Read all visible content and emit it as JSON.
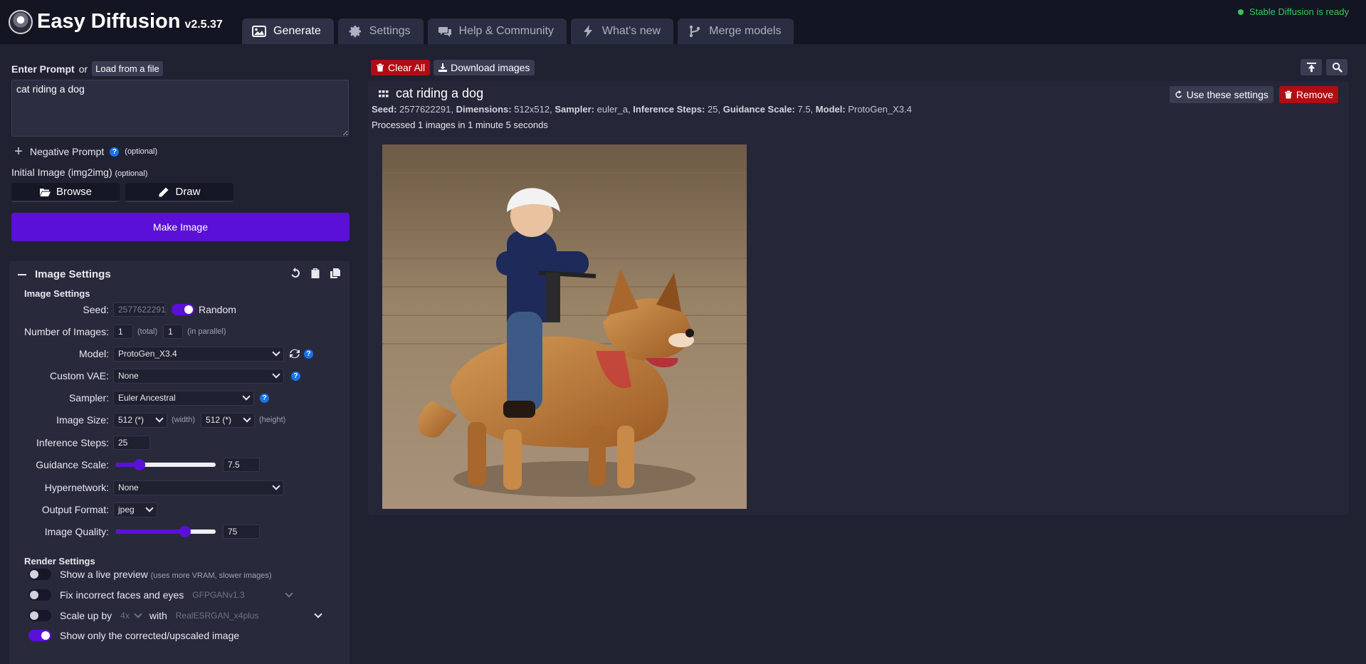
{
  "app": {
    "name": "Easy Diffusion",
    "version": "v2.5.37",
    "status": "Stable Diffusion is ready"
  },
  "tabs": [
    {
      "label": "Generate",
      "icon": "image-icon",
      "active": true
    },
    {
      "label": "Settings",
      "icon": "gear-icon",
      "active": false
    },
    {
      "label": "Help & Community",
      "icon": "comments-icon",
      "active": false
    },
    {
      "label": "What's new",
      "icon": "bolt-icon",
      "active": false
    },
    {
      "label": "Merge models",
      "icon": "code-branch-icon",
      "active": false
    }
  ],
  "prompt": {
    "label": "Enter Prompt",
    "or": "or",
    "load_button": "Load from a file",
    "value": "cat riding a dog",
    "negative_label": "Negative Prompt",
    "optional": "(optional)",
    "initial_image_label": "Initial Image (img2img)",
    "browse": "Browse",
    "draw": "Draw",
    "make_image": "Make Image"
  },
  "image_settings": {
    "panel_title": "Image Settings",
    "section_title": "Image Settings",
    "seed": {
      "label": "Seed:",
      "value": "2577622291",
      "random_label": "Random",
      "random_on": true
    },
    "num_images": {
      "label": "Number of Images:",
      "total": "1",
      "total_hint": "(total)",
      "parallel": "1",
      "parallel_hint": "(in parallel)"
    },
    "model": {
      "label": "Model:",
      "value": "ProtoGen_X3.4"
    },
    "vae": {
      "label": "Custom VAE:",
      "value": "None"
    },
    "sampler": {
      "label": "Sampler:",
      "value": "Euler Ancestral"
    },
    "image_size": {
      "label": "Image Size:",
      "width": "512 (*)",
      "width_hint": "(width)",
      "height": "512 (*)",
      "height_hint": "(height)"
    },
    "steps": {
      "label": "Inference Steps:",
      "value": "25"
    },
    "guidance": {
      "label": "Guidance Scale:",
      "value": "7.5",
      "fraction": 0.2
    },
    "hypernetwork": {
      "label": "Hypernetwork:",
      "value": "None"
    },
    "output_format": {
      "label": "Output Format:",
      "value": "jpeg"
    },
    "quality": {
      "label": "Image Quality:",
      "value": "75",
      "fraction": 0.72
    }
  },
  "render_settings": {
    "title": "Render Settings",
    "live_preview": {
      "label": "Show a live preview",
      "hint": "(uses more VRAM, slower images)",
      "on": false
    },
    "fix_faces": {
      "label": "Fix incorrect faces and eyes",
      "model": "GFPGANv1.3",
      "on": false
    },
    "upscale": {
      "label": "Scale up by",
      "factor": "4x",
      "with": "with",
      "model": "RealESRGAN_x4plus",
      "on": false
    },
    "corrected_only": {
      "label": "Show only the corrected/upscaled image",
      "on": true
    }
  },
  "output": {
    "clear_all": "Clear All",
    "download": "Download images",
    "task_title": "cat riding a dog",
    "use_settings": "Use these settings",
    "remove": "Remove",
    "info": {
      "seed_label": "Seed:",
      "seed": "2577622291",
      "dim_label": "Dimensions:",
      "dim": "512x512",
      "sampler_label": "Sampler:",
      "sampler": "euler_a",
      "steps_label": "Inference Steps:",
      "steps": "25",
      "guidance_label": "Guidance Scale:",
      "guidance": "7.5",
      "model_label": "Model:",
      "model": "ProtoGen_X3.4"
    },
    "processed": "Processed 1 images in 1 minute 5 seconds"
  },
  "colors": {
    "accent": "#5b10d8",
    "danger": "#b00d12",
    "ready": "#34c759",
    "background": "#202232"
  }
}
